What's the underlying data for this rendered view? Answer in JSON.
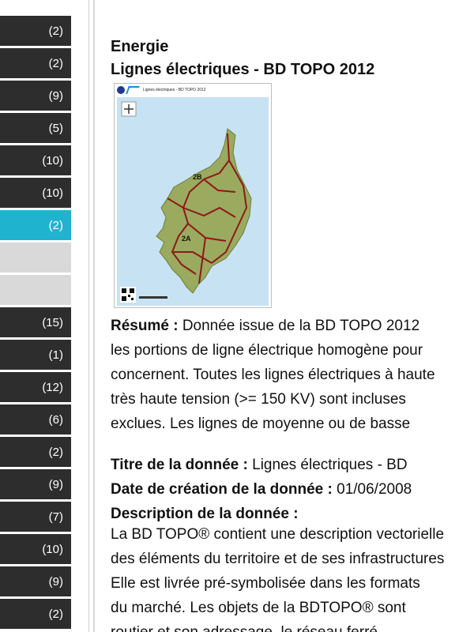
{
  "sidebar": {
    "items": [
      {
        "count": "(2)"
      },
      {
        "count": "(2)"
      },
      {
        "count": "(9)"
      },
      {
        "count": "(5)"
      },
      {
        "count": "(10)"
      },
      {
        "count": "(10)"
      },
      {
        "count": "(2)",
        "active": true
      },
      {
        "count": ""
      },
      {
        "count": ""
      },
      {
        "count": "(15)"
      },
      {
        "count": "(1)"
      },
      {
        "count": "(12)"
      },
      {
        "count": "(6)"
      },
      {
        "count": "(2)"
      },
      {
        "count": "(9)"
      },
      {
        "count": "(7)"
      },
      {
        "count": "(10)"
      },
      {
        "count": "(9)"
      },
      {
        "count": "(2)"
      }
    ]
  },
  "main": {
    "category": "Energie",
    "title": "Lignes électriques - BD TOPO 2012",
    "thumbnail": {
      "caption": "Lignes électriques - BD TOPO 2012",
      "labels": [
        "2B",
        "2A"
      ]
    },
    "resume": {
      "label": "Résumé :",
      "lines": [
        "Donnée issue de la BD TOPO 2012",
        "les portions de ligne électrique homogène pour",
        "concernent. Toutes les lignes électriques à haute",
        "très haute tension (>= 150 KV) sont incluses",
        "exclues. Les lignes de moyenne ou de basse"
      ]
    },
    "meta": {
      "titre_label": "Titre de la donnée :",
      "titre_value": "Lignes électriques - BD",
      "date_label": "Date de création de la donnée :",
      "date_value": "01/06/2008",
      "description_label": "Description de la donnée :"
    },
    "description": {
      "lines": [
        "La BD TOPO® contient une description vectorielle",
        "des éléments du territoire et de ses infrastructures",
        "Elle est livrée pré-symbolisée dans les formats",
        "du marché. Les objets de la BDTOPO® sont",
        "routier et son adressage, le réseau ferré"
      ]
    }
  },
  "colors": {
    "sidebar_item": "#2d2d2d",
    "sidebar_active": "#1fb3cf",
    "sidebar_empty": "#d9d9d9",
    "sea": "#b9dbef",
    "land": "#9aaa5e",
    "power_lines": "#8b1a1a"
  }
}
